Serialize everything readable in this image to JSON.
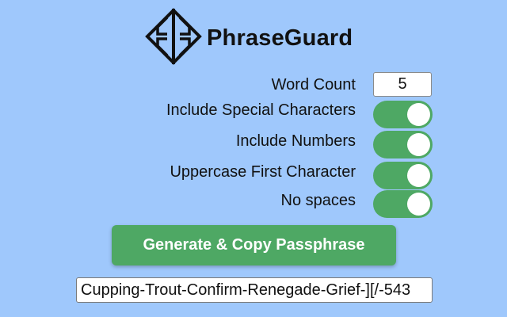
{
  "app": {
    "title": "PhraseGuard",
    "logo_icon": "shield-logo-icon"
  },
  "options": {
    "word_count_label": "Word Count",
    "word_count_value": "5",
    "special_chars_label": "Include Special Characters",
    "special_chars_on": true,
    "numbers_label": "Include Numbers",
    "numbers_on": true,
    "uppercase_label": "Uppercase First Character",
    "uppercase_on": true,
    "no_spaces_label": "No spaces",
    "no_spaces_on": true
  },
  "actions": {
    "generate_label": "Generate & Copy Passphrase"
  },
  "output": {
    "passphrase": "Cupping-Trout-Confirm-Renegade-Grief-][/-543"
  },
  "colors": {
    "background": "#9fc8fc",
    "accent": "#4ea864",
    "text": "#111111"
  }
}
